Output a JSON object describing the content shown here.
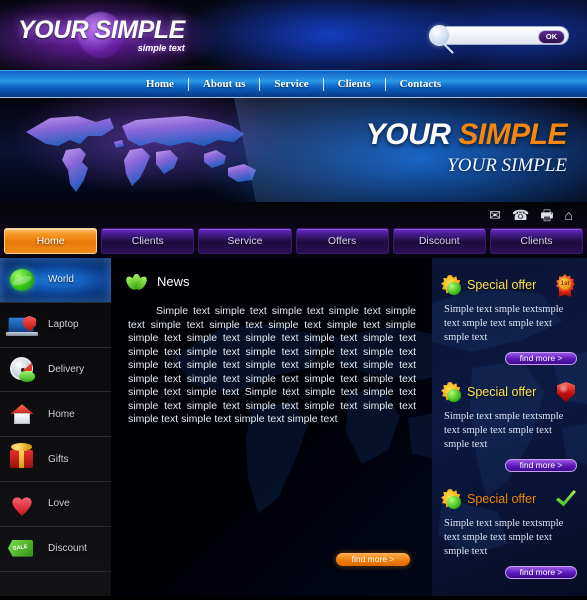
{
  "header": {
    "logo_main": "YOUR SIMPLE",
    "logo_sub": "simple text",
    "search": {
      "value": "",
      "placeholder": "",
      "ok_label": "OK"
    }
  },
  "topnav": {
    "items": [
      {
        "label": "Home"
      },
      {
        "label": "About us"
      },
      {
        "label": "Service"
      },
      {
        "label": "Clients"
      },
      {
        "label": "Contacts"
      }
    ]
  },
  "hero": {
    "title_white": "YOUR",
    "title_orange": "SIMPLE",
    "subtitle": "YOUR SIMPLE"
  },
  "iconstrip": {
    "icons": [
      {
        "name": "mail-icon",
        "glyph": "✉"
      },
      {
        "name": "phone-icon",
        "glyph": "☎"
      },
      {
        "name": "print-icon",
        "glyph": "Ὓ6"
      },
      {
        "name": "home-icon",
        "glyph": "⌂"
      }
    ]
  },
  "tabs": [
    {
      "label": "Home",
      "active": true
    },
    {
      "label": "Clients",
      "active": false
    },
    {
      "label": "Service",
      "active": false
    },
    {
      "label": "Offers",
      "active": false
    },
    {
      "label": "Discount",
      "active": false
    },
    {
      "label": "Clients",
      "active": false
    }
  ],
  "sidebar": {
    "items": [
      {
        "label": "World",
        "icon": "globe-icon",
        "active": true
      },
      {
        "label": "Laptop",
        "icon": "laptop-icon",
        "active": false
      },
      {
        "label": "Delivery",
        "icon": "timer-icon",
        "active": false
      },
      {
        "label": "Home",
        "icon": "house-icon",
        "active": false
      },
      {
        "label": "Gifts",
        "icon": "gift-icon",
        "active": false
      },
      {
        "label": "Love",
        "icon": "heart-icon",
        "active": false
      },
      {
        "label": "Discount",
        "icon": "sale-tag-icon",
        "active": false,
        "tag_text": "SALE"
      }
    ]
  },
  "news": {
    "title": "News",
    "icon": "leaf-icon",
    "body": "Simple text simple text simple text simple text simple text simple text simple text simple text simple text simple simple text simple text simple text simple text simple text simple text simple text simple text simple text simple text simple text simple text simple text simple text simple text simple text simple text simple text simple text simple text simple text simple text Simple text simple text simple text simple text simple text simple text simple text simple text simple text simple text simple text simple text",
    "find_more_label": "find more >"
  },
  "offers": [
    {
      "title": "Special offer",
      "title_color": "#ffe14d",
      "badge": "first-place-rosette-icon",
      "badge_text": "1st",
      "text": "Simple text smple textsmple text smple text smple text smple text",
      "find_more_label": "find more >"
    },
    {
      "title": "Special offer",
      "title_color": "#ffe14d",
      "badge": "shield-icon",
      "badge_text": "",
      "text": "Simple text smple textsmple text smple text smple text smple text",
      "find_more_label": "find more >"
    },
    {
      "title": "Special offer",
      "title_color": "#f2860f",
      "badge": "check-icon",
      "badge_text": "",
      "text": "Simple text smple textsmple text smple text smple text smple text",
      "find_more_label": "find more >"
    }
  ],
  "colors": {
    "accent_orange": "#f2860f",
    "accent_purple": "#5a18b8",
    "accent_blue": "#1f7fe8",
    "offer_yellow": "#ffe14d"
  }
}
